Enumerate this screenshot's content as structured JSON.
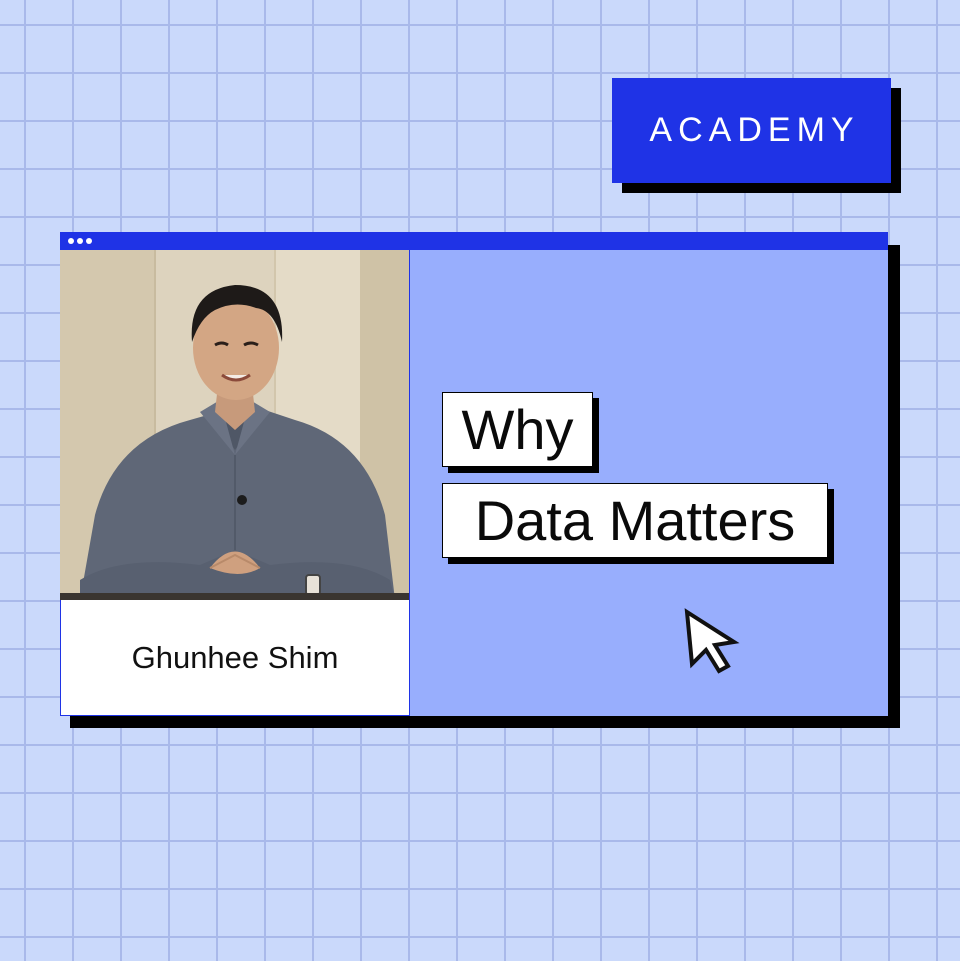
{
  "badge": {
    "label": "ACADEMY"
  },
  "window": {
    "title_dots": 3
  },
  "speaker": {
    "name": "Ghunhee Shim",
    "photo": "speaker-portrait"
  },
  "title": {
    "line1": "Why",
    "line2": "Data Matters"
  },
  "icons": {
    "cursor": "arrow-cursor-icon"
  },
  "colors": {
    "background": "#cad9fb",
    "grid": "#a9b9ea",
    "accent_blue": "#1f33e6",
    "panel_blue": "#98aefd",
    "shadow": "#000000",
    "label_bg": "#ffffff"
  }
}
